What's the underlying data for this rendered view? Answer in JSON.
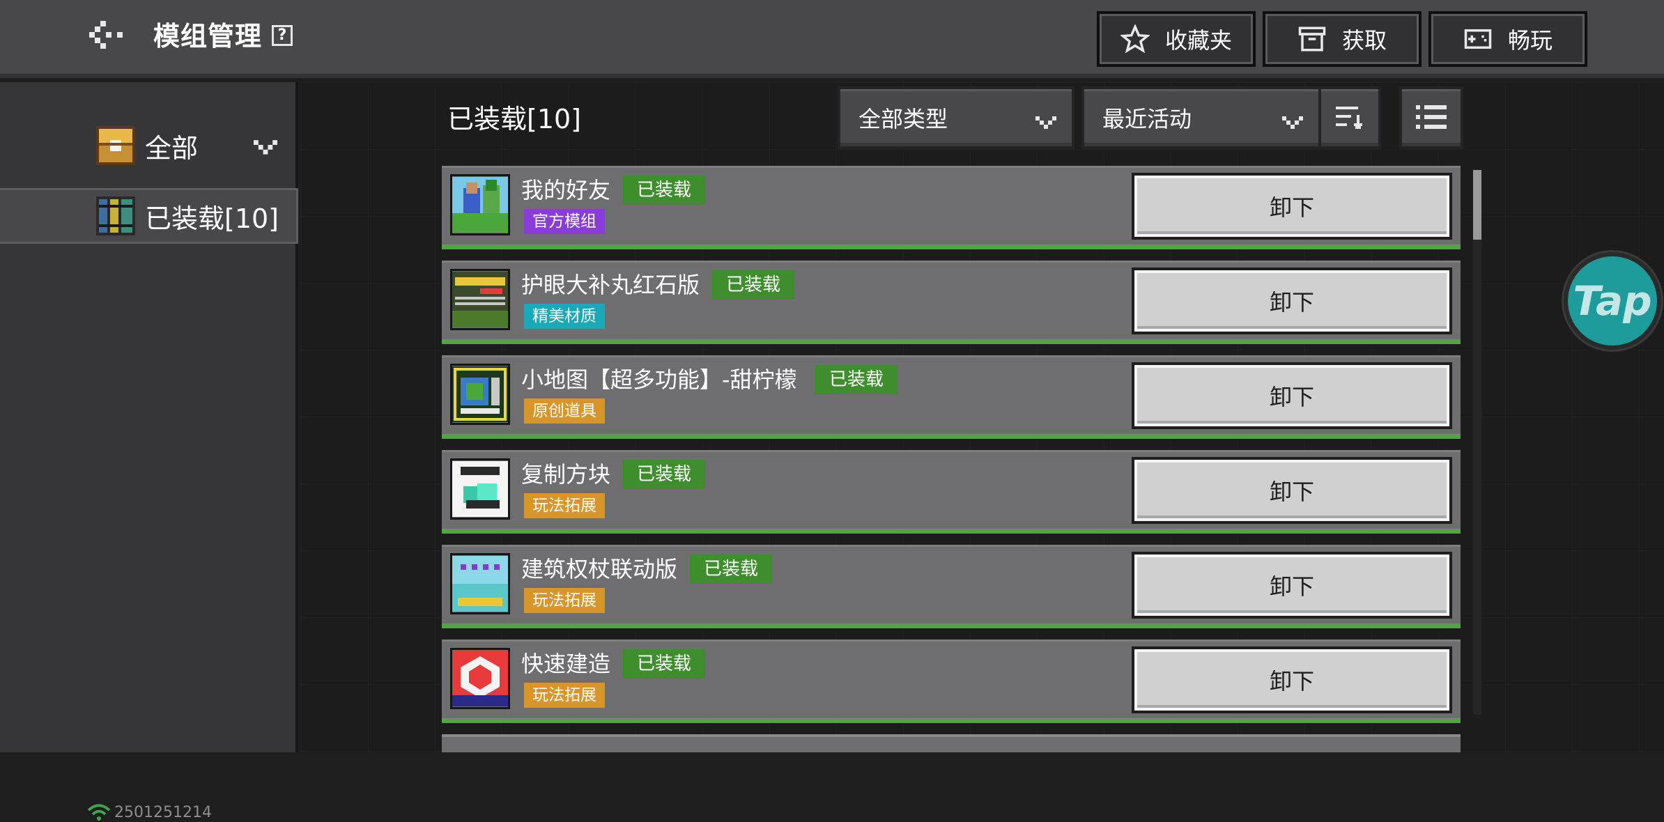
{
  "header": {
    "title": "模组管理",
    "help_label": "?",
    "favorites_label": "收藏夹",
    "obtain_label": "获取",
    "play_label": "畅玩"
  },
  "sidebar": {
    "items": [
      {
        "label": "全部",
        "icon": "chest-icon"
      },
      {
        "label": "已装载[10]",
        "icon": "books-icon"
      }
    ],
    "status_id": "2501251214"
  },
  "main": {
    "section_title": "已装载[10]",
    "type_filter": "全部类型",
    "sort_filter": "最近活动"
  },
  "mods": [
    {
      "name": "我的好友",
      "badge": "已装载",
      "category": "官方模组",
      "category_color": "#8a3cd8",
      "action": "卸下"
    },
    {
      "name": "护眼大补丸红石版",
      "badge": "已装载",
      "category": "精美材质",
      "category_color": "#1aa9b8",
      "action": "卸下"
    },
    {
      "name": "小地图【超多功能】-甜柠檬",
      "badge": "已装载",
      "category": "原创道具",
      "category_color": "#d8962a",
      "action": "卸下"
    },
    {
      "name": "复制方块",
      "badge": "已装载",
      "category": "玩法拓展",
      "category_color": "#d8962a",
      "action": "卸下"
    },
    {
      "name": "建筑权杖联动版",
      "badge": "已装载",
      "category": "玩法拓展",
      "category_color": "#d8962a",
      "action": "卸下"
    },
    {
      "name": "快速建造",
      "badge": "已装载",
      "category": "玩法拓展",
      "category_color": "#d8962a",
      "action": "卸下"
    }
  ],
  "floating": {
    "label": "Tap"
  },
  "colors": {
    "installed_green": "#3e8e2e",
    "row_border_green": "#4caa3a",
    "tap_teal": "#1e9c9c"
  }
}
